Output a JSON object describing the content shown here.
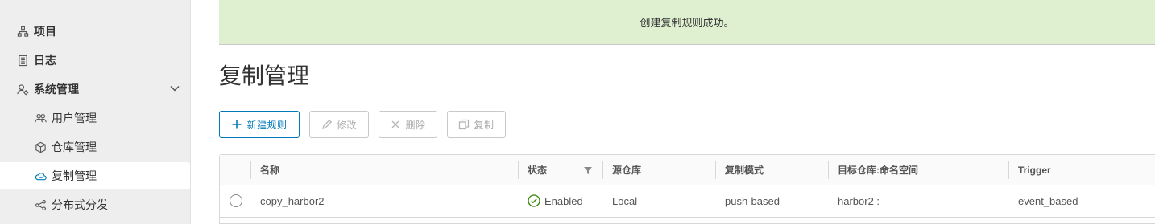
{
  "sidebar": {
    "items": [
      {
        "label": "项目",
        "icon": "project-icon"
      },
      {
        "label": "日志",
        "icon": "log-icon"
      },
      {
        "label": "系统管理",
        "icon": "system-admin-icon"
      },
      {
        "label": "用户管理",
        "icon": "users-icon"
      },
      {
        "label": "仓库管理",
        "icon": "registry-box-icon"
      },
      {
        "label": "复制管理",
        "icon": "cloud-replication-icon",
        "active": true
      },
      {
        "label": "分布式分发",
        "icon": "share-icon"
      }
    ]
  },
  "banner": {
    "message": "创建复制规则成功。",
    "color": "#dff0d0"
  },
  "page": {
    "title": "复制管理"
  },
  "toolbar": {
    "new_label": "新建规则",
    "edit_label": "修改",
    "delete_label": "删除",
    "copy_label": "复制"
  },
  "table": {
    "columns": [
      "名称",
      "状态",
      "源仓库",
      "复制模式",
      "目标仓库:命名空间",
      "Trigger"
    ],
    "rows": [
      {
        "name": "copy_harbor2",
        "status": "Enabled",
        "source": "Local",
        "mode": "push-based",
        "destination": "harbor2 : -",
        "trigger": "event_based"
      }
    ]
  },
  "colors": {
    "accent": "#0079b8",
    "success": "#2f8400",
    "sidebar_bg": "#eeeeee"
  }
}
